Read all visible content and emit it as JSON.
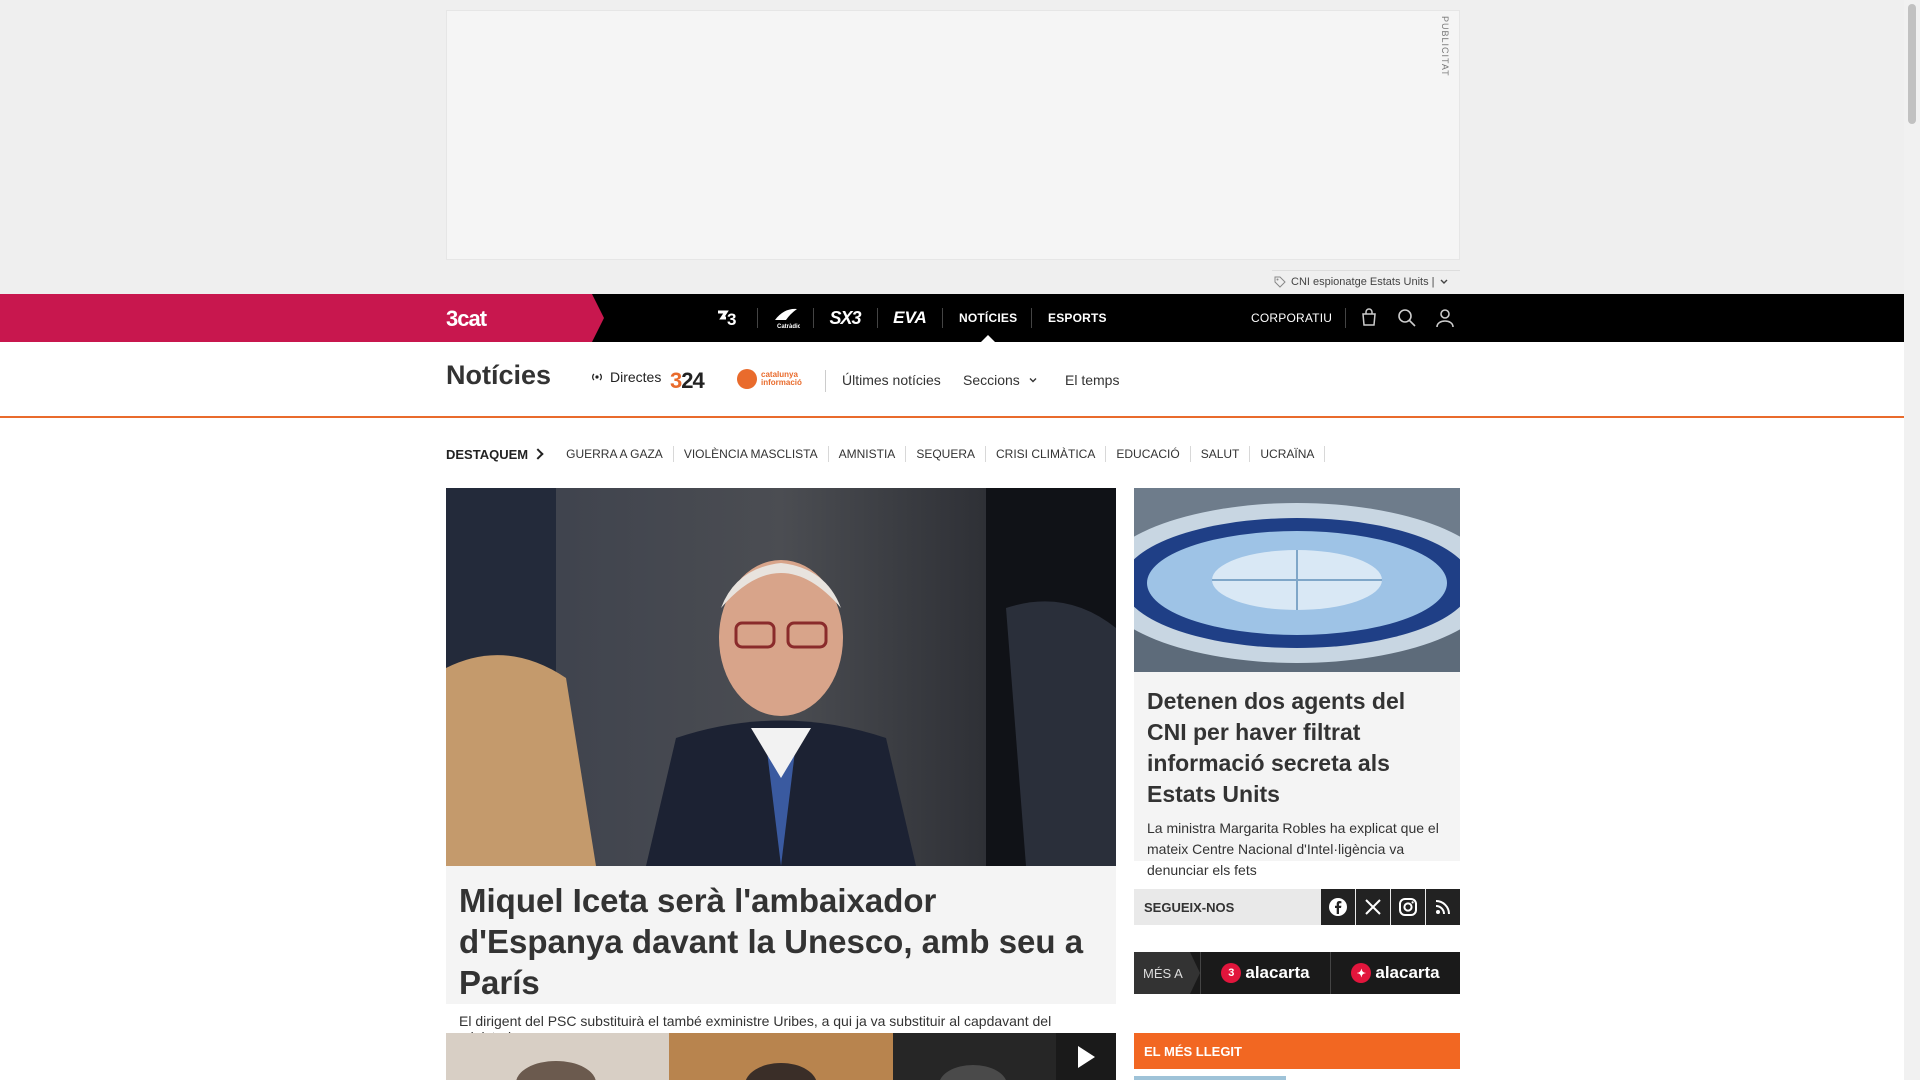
{
  "ad": {
    "label": "PUBLICITAT",
    "tagline": "CNI espionatge Estats Units |"
  },
  "topnav": {
    "brand": "3cat",
    "channels": [
      "TV3",
      "Catràdio",
      "SX3",
      "EVA"
    ],
    "links": [
      "NOTÍCIES",
      "ESPORTS"
    ],
    "corporate": "CORPORATIU",
    "icons": [
      "store-icon",
      "search-icon",
      "user-icon"
    ]
  },
  "section": {
    "title": "Notícies",
    "directes": "Directes",
    "logo_324": "324",
    "logo_catinfo": [
      "catalunya",
      "informació"
    ],
    "nav": [
      "Últimes notícies",
      "Seccions",
      "El temps"
    ]
  },
  "destaquem": {
    "label": "DESTAQUEM",
    "tags": [
      "GUERRA A GAZA",
      "VIOLÈNCIA MASCLISTA",
      "AMNISTIA",
      "SEQUERA",
      "CRISI CLIMÀTICA",
      "EDUCACIÓ",
      "SALUT",
      "UCRAÏNA"
    ]
  },
  "main_article": {
    "title": "Miquel Iceta serà l'ambaixador d'Espanya davant la Unesco, amb seu a París",
    "summary": "El dirigent del PSC substituirà el també exministre Uribes, a qui ja va substituir al capdavant del ministeri"
  },
  "side_article": {
    "title": "Detenen dos agents del CNI per haver filtrat informació secreta als Estats Units",
    "summary": "La ministra Margarita Robles ha explicat que el mateix Centre Nacional d'Intel·ligència va denunciar els fets"
  },
  "follow": {
    "label": "SEGUEIX-NOS",
    "networks": [
      "facebook-icon",
      "x-icon",
      "instagram-icon",
      "rss-icon"
    ]
  },
  "mes_a": {
    "label": "MÉS A",
    "items": [
      "alacarta",
      "alacarta"
    ]
  },
  "most_read": {
    "label": "EL MÉS LLEGIT"
  }
}
